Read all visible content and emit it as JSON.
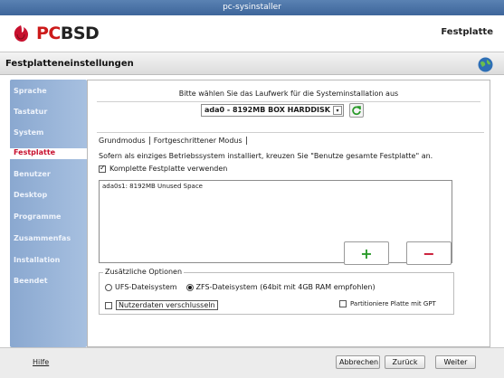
{
  "window": {
    "title": "pc-sysinstaller"
  },
  "header": {
    "logo_text_red": "PC",
    "logo_text_dark": "BSD",
    "page_label": "Festplatte"
  },
  "section": {
    "title": "Festplatteneinstellungen"
  },
  "sidebar": {
    "items": [
      {
        "label": "Sprache",
        "active": false
      },
      {
        "label": "Tastatur",
        "active": false
      },
      {
        "label": "System",
        "active": false
      },
      {
        "label": "Festplatte",
        "active": true
      },
      {
        "label": "Benutzer",
        "active": false
      },
      {
        "label": "Desktop",
        "active": false
      },
      {
        "label": "Programme",
        "active": false
      },
      {
        "label": "Zusammenfas",
        "active": false
      },
      {
        "label": "Installation",
        "active": false
      },
      {
        "label": "Beendet",
        "active": false
      }
    ]
  },
  "main": {
    "prompt": "Bitte wählen Sie das Laufwerk für die Systeminstallation aus",
    "disk_select": {
      "value": "ada0 - 8192MB BOX HARDDISK"
    },
    "tabs": [
      {
        "label": "Grundmodus",
        "selected": true
      },
      {
        "label": "Fortgeschrittener Modus",
        "selected": false
      }
    ],
    "info_text": "Sofern als einziges Betriebssystem installiert, kreuzen Sie \"Benutze gesamte Festplatte\" an.",
    "use_full_disk": {
      "label": "Komplette Festplatte verwenden",
      "checked": true
    },
    "partitions": [
      "ada0s1: 8192MB Unused Space"
    ],
    "options": {
      "legend": "Zusätzliche Optionen",
      "ufs_label": "UFS-Dateisystem",
      "zfs_label": "ZFS-Dateisystem (64bit mit 4GB RAM empfohlen)",
      "selected_fs": "zfs",
      "encrypt_label": "Nutzerdaten verschlusseln",
      "gpt_label": "Partitioniere Platte mit GPT"
    }
  },
  "footer": {
    "help_label": "Hilfe",
    "cancel_label": "Abbrechen",
    "back_label": "Zurück",
    "next_label": "Weiter"
  },
  "colors": {
    "accent_red": "#c8102e",
    "sidebar_blue": "#9bb6da",
    "add_green": "#2a9a2a"
  }
}
